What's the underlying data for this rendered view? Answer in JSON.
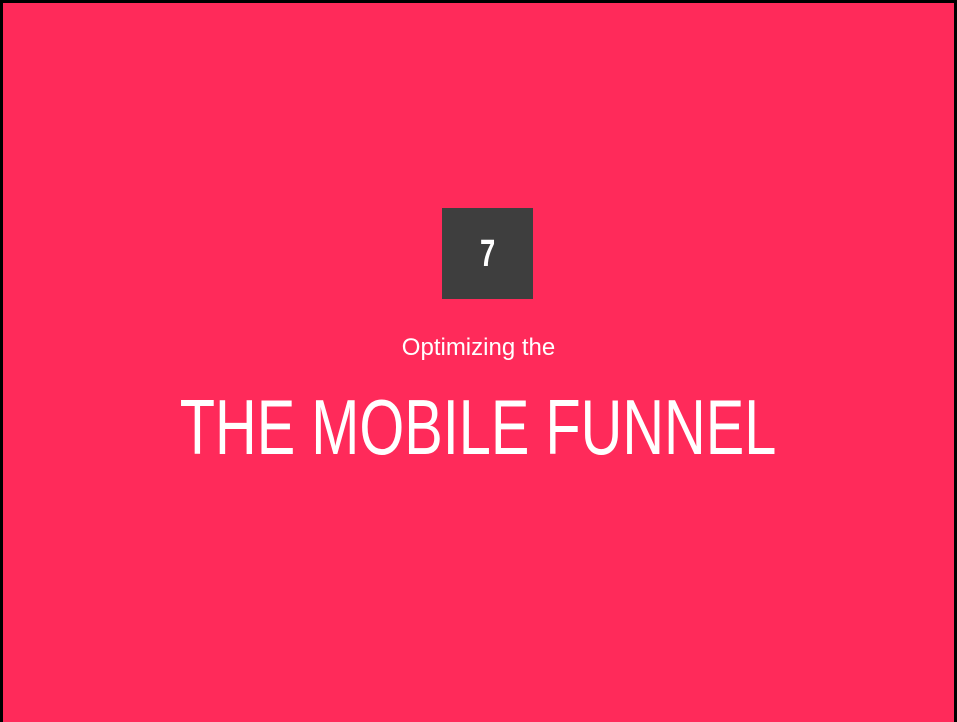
{
  "slide": {
    "section_number": "7",
    "subtitle": "Optimizing the",
    "title": "THE MOBILE FUNNEL"
  },
  "colors": {
    "background": "#FF2A5A",
    "badge": "#3E3E3E",
    "text": "#FFFFFF",
    "border": "#000000"
  }
}
